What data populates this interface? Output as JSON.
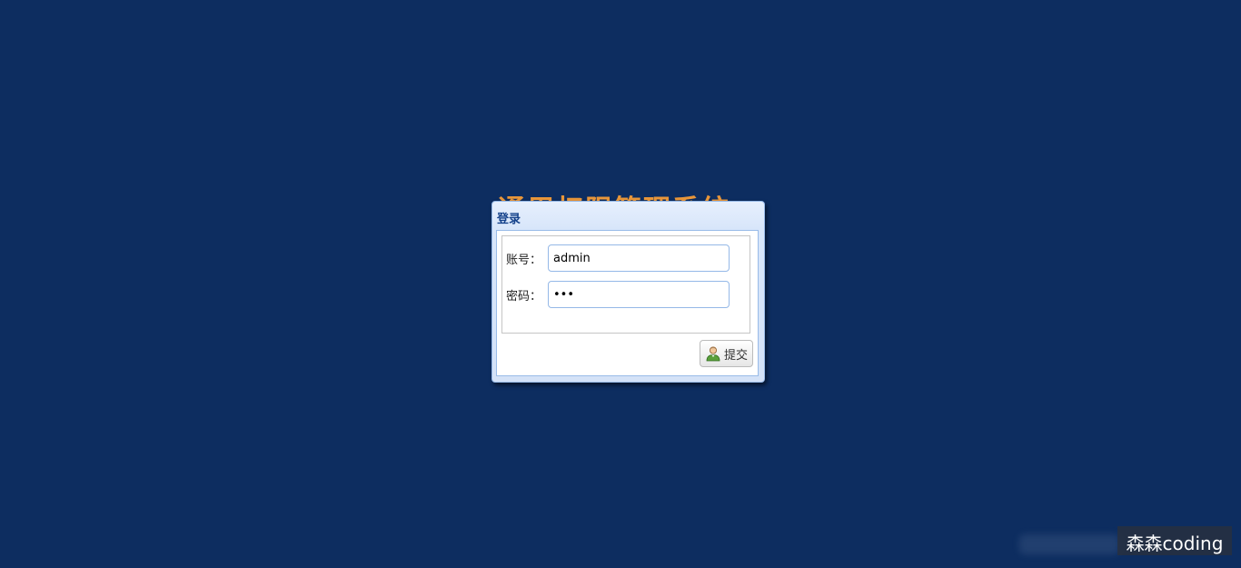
{
  "backdrop": {
    "title": "通用权限管理系统"
  },
  "login_window": {
    "title": "登录",
    "account_label": "账号：",
    "account_value": "admin",
    "password_label": "密码：",
    "password_value": "123",
    "submit_label": "提交",
    "submit_icon": "user-icon"
  },
  "watermark": {
    "text": "森森coding"
  },
  "colors": {
    "background": "#0d2d60",
    "title_accent": "#e8963a",
    "window_title": "#15428b",
    "input_border": "#95b8e7"
  }
}
